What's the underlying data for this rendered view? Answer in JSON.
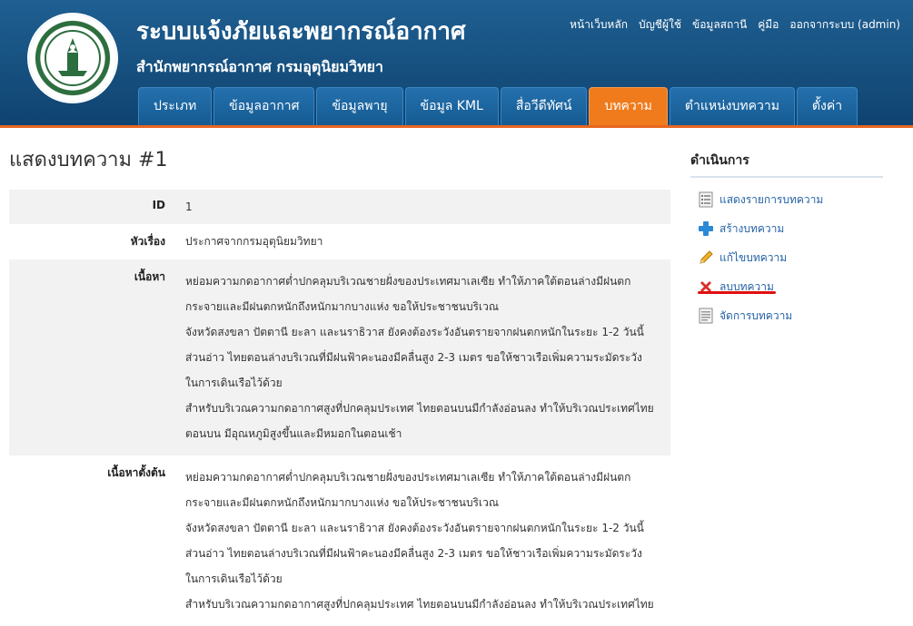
{
  "header": {
    "title": "ระบบแจ้งภัยและพยากรณ์อากาศ",
    "subtitle": "สำนักพยากรณ์อากาศ กรมอุตุนิยมวิทยา",
    "logo_text": "METEOROLOGICAL DEPARTMENT",
    "top_links": [
      "หน้าเว็บหลัก",
      "บัญชีผู้ใช้",
      "ข้อมูลสถานี",
      "คู่มือ",
      "ออกจากระบบ (admin)"
    ],
    "tabs": [
      "ประเภท",
      "ข้อมูลอากาศ",
      "ข้อมูลพายุ",
      "ข้อมูล KML",
      "สื่อวีดีทัศน์",
      "บทความ",
      "ตำแหน่งบทความ",
      "ตั้งค่า"
    ],
    "active_tab": "บทความ"
  },
  "main": {
    "heading": "แสดงบทความ #1",
    "rows": [
      {
        "label": "ID",
        "value": "1"
      },
      {
        "label": "หัวเรื่อง",
        "value": "ประกาศจากกรมอุตุนิยมวิทยา"
      }
    ],
    "content_label": "เนื้อหา",
    "content_lines": [
      "หย่อมความกดอากาศต่ำปกคลุมบริเวณชายฝั่งของประเทศมาเลเซีย ทำให้ภาคใต้ตอนล่างมีฝนตก",
      "กระจายและมีฝนตกหนักถึงหนักมากบางแห่ง ขอให้ประชาชนบริเวณ",
      "จังหวัดสงขลา ปัตตานี ยะลา และนราธิวาส ยังคงต้องระวังอันตรายจากฝนตกหนักในระยะ 1-2 วันนี้",
      "ส่วนอ่าว ไทยตอนล่างบริเวณที่มีฝนฟ้าคะนองมีคลื่นสูง 2-3 เมตร ขอให้ชาวเรือเพิ่มความระมัดระวัง",
      "ในการเดินเรือไว้ด้วย",
      "สำหรับบริเวณความกดอากาศสูงที่ปกคลุมประเทศ ไทยตอนบนมีกำลังอ่อนลง ทำให้บริเวณประเทศไทย",
      "ตอนบน มีอุณหภูมิสูงขึ้นและมีหมอกในตอนเช้า"
    ],
    "original_label": "เนื้อหาตั้งต้น",
    "original_lines": [
      "หย่อมความกดอากาศต่ำปกคลุมบริเวณชายฝั่งของประเทศมาเลเซีย ทำให้ภาคใต้ตอนล่างมีฝนตก",
      "กระจายและมีฝนตกหนักถึงหนักมากบางแห่ง ขอให้ประชาชนบริเวณ",
      "จังหวัดสงขลา ปัตตานี ยะลา และนราธิวาส ยังคงต้องระวังอันตรายจากฝนตกหนักในระยะ 1-2 วันนี้",
      "ส่วนอ่าว ไทยตอนล่างบริเวณที่มีฝนฟ้าคะนองมีคลื่นสูง 2-3 เมตร ขอให้ชาวเรือเพิ่มความระมัดระวัง",
      "ในการเดินเรือไว้ด้วย",
      "สำหรับบริเวณความกดอากาศสูงที่ปกคลุมประเทศ ไทยตอนบนมีกำลังอ่อนลง ทำให้บริเวณประเทศไทย"
    ]
  },
  "sidebar": {
    "title": "ดำเนินการ",
    "operations": [
      {
        "label": "แสดงรายการบทความ",
        "icon": "list-icon"
      },
      {
        "label": "สร้างบทความ",
        "icon": "plus-icon"
      },
      {
        "label": "แก้ไขบทความ",
        "icon": "pencil-icon"
      },
      {
        "label": "ลบบทความ",
        "icon": "delete-icon"
      },
      {
        "label": "จัดการบทความ",
        "icon": "manage-icon"
      }
    ]
  },
  "colors": {
    "header_blue": "#16507f",
    "active_tab": "#f07b1c",
    "link": "#2563a6",
    "highlight_underline": "#e01010"
  }
}
